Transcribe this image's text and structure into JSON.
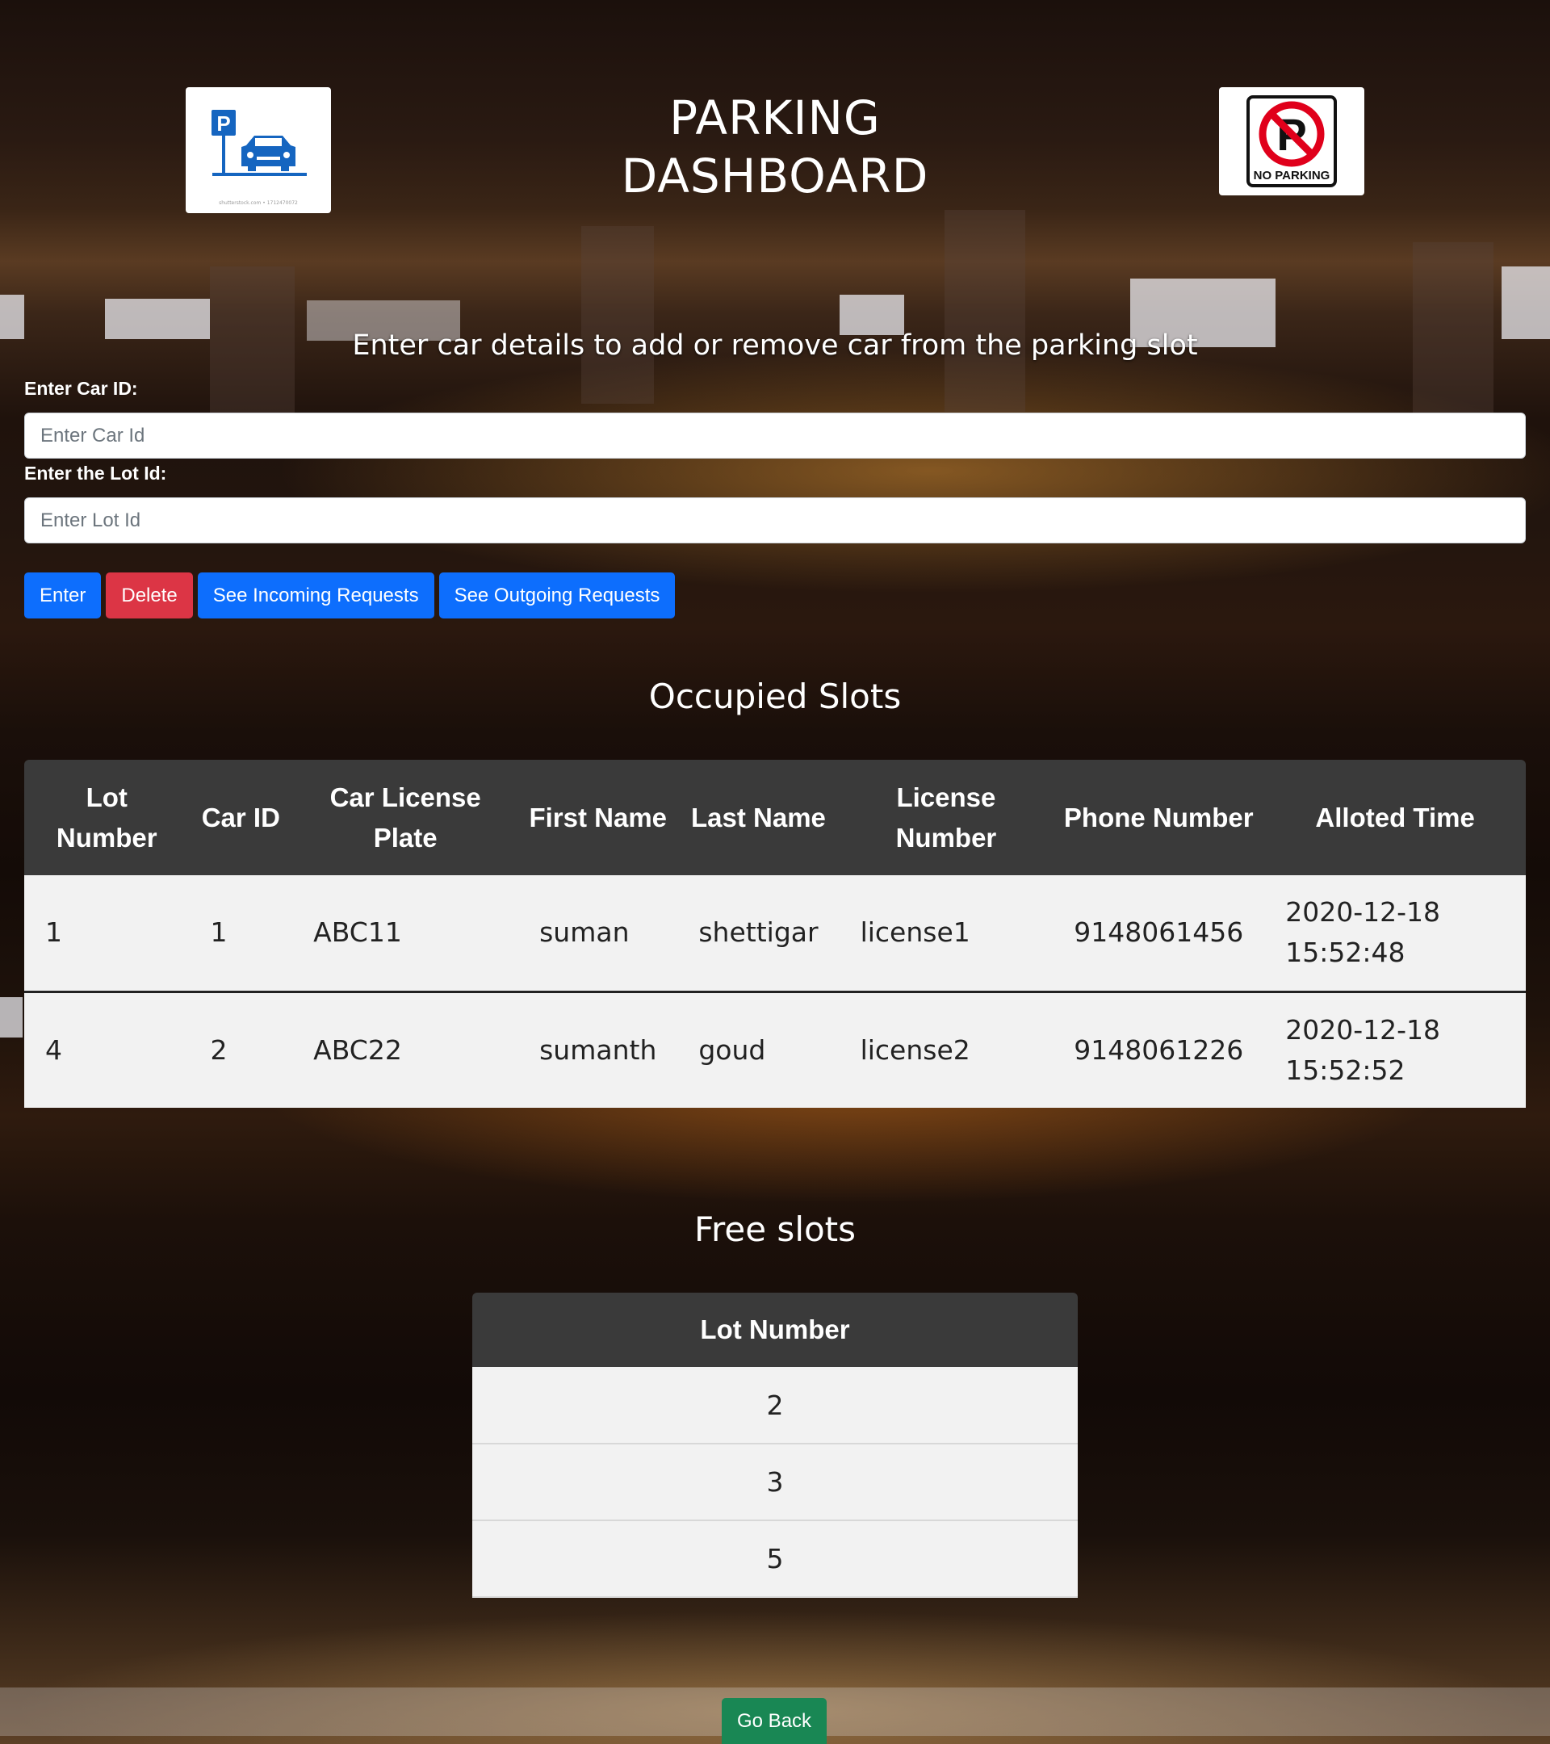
{
  "header": {
    "title_line1": "PARKING",
    "title_line2": "DASHBOARD",
    "left_logo_icon": "parking-car-icon",
    "right_logo_icon": "no-parking-icon",
    "no_parking_text": "NO PARKING"
  },
  "form": {
    "subtitle": "Enter car details to add or remove car from the parking slot",
    "car_id_label": "Enter Car ID:",
    "car_id_placeholder": "Enter Car Id",
    "lot_id_label": "Enter the Lot Id:",
    "lot_id_placeholder": "Enter Lot Id"
  },
  "buttons": {
    "enter": "Enter",
    "delete": "Delete",
    "incoming": "See Incoming Requests",
    "outgoing": "See Outgoing Requests",
    "go_back": "Go Back"
  },
  "occupied": {
    "title": "Occupied Slots",
    "headers": [
      "Lot Number",
      "Car ID",
      "Car License Plate",
      "First Name",
      "Last Name",
      "License Number",
      "Phone Number",
      "Alloted Time"
    ],
    "rows": [
      [
        "1",
        "1",
        "ABC11",
        "suman",
        "shettigar",
        "license1",
        "9148061456",
        "2020-12-18 15:52:48"
      ],
      [
        "4",
        "2",
        "ABC22",
        "sumanth",
        "goud",
        "license2",
        "9148061226",
        "2020-12-18 15:52:52"
      ]
    ]
  },
  "free": {
    "title": "Free slots",
    "header": "Lot Number",
    "rows": [
      "2",
      "3",
      "5"
    ]
  },
  "colors": {
    "primary": "#0d6efd",
    "danger": "#dc3545",
    "success": "#198754",
    "table_header": "#3a3a3a",
    "table_row": "#f2f2f2"
  }
}
